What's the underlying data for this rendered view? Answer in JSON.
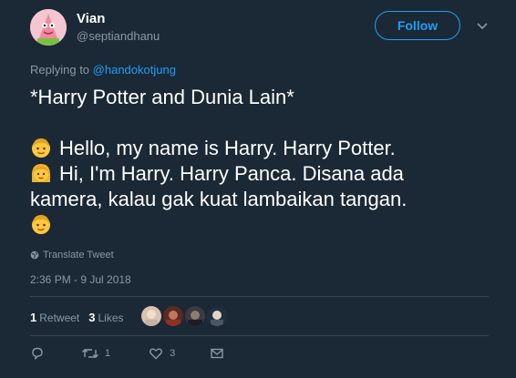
{
  "user": {
    "display_name": "Vian",
    "handle": "@septiandhanu"
  },
  "follow_label": "Follow",
  "reply": {
    "prefix": "Replying to ",
    "to": "@handokotjung"
  },
  "tweet": {
    "title": "*Harry Potter and Dunia Lain*",
    "line1": "Hello, my name is Harry. Harry Potter.",
    "line2": "Hi, I'm Harry. Harry Panca. Disana ada",
    "line3": "kamera, kalau gak kuat lambaikan tangan."
  },
  "translate_label": "Translate Tweet",
  "timestamp": "2:36 PM - 9 Jul 2018",
  "stats": {
    "retweets_count": "1",
    "retweets_label": "Retweet",
    "likes_count": "3",
    "likes_label": "Likes"
  },
  "actions": {
    "retweet_count": "1",
    "like_count": "3"
  },
  "colors": {
    "background": "#1b2836",
    "accent": "#1da1f2",
    "muted": "#8899a6",
    "divider": "#38444d"
  },
  "icons": [
    "reply-icon",
    "retweet-icon",
    "like-icon",
    "direct-message-icon",
    "globe-icon",
    "chevron-down-icon"
  ]
}
